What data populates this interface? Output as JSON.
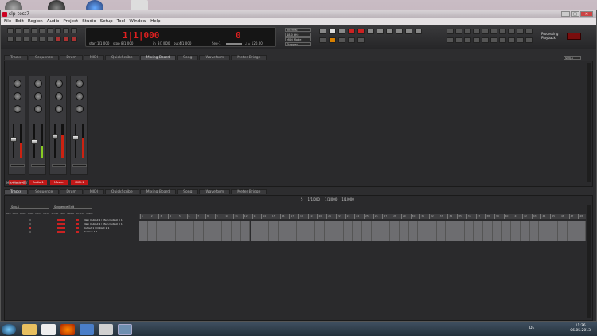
{
  "window": {
    "title": "slp-test7"
  },
  "menu": [
    "File",
    "Edit",
    "Region",
    "Audio",
    "Project",
    "Studio",
    "Setup",
    "Tool",
    "Window",
    "Help"
  ],
  "transport": {
    "main_counter": "1|1|000",
    "start_label": "start",
    "start_value": "1|1|000",
    "stop_label": "stop",
    "stop_value": "8|1|000",
    "in_label": "in",
    "in_value": "3|1|000",
    "out_label": "out",
    "out_value": "4|1|000",
    "sequence": "Seq-1",
    "tempo": "♩ = 120.00",
    "right_counter": "0"
  },
  "sync": [
    "Internal",
    "48.0 kHz",
    "MIDI Mode",
    "Stopped"
  ],
  "status": {
    "line1": "Processing",
    "line2": "Playback"
  },
  "tabs": [
    "Tracks",
    "Sequence",
    "Drum",
    "MIDI",
    "QuickScribe",
    "Mixing Board",
    "Song",
    "Waveform",
    "Meter Bridge"
  ],
  "mixer": {
    "active_tab": "Mixing Board",
    "top_dropdown": "Seq-1",
    "channel_labels": [
      "Instrument",
      "Audio-1",
      "Master",
      "MIDI-1"
    ],
    "track_selector": "Mix Mode Off",
    "meter_levels": [
      0.45,
      0.35,
      0.7,
      0.6
    ],
    "fader_levels": [
      0.62,
      0.55,
      0.72,
      0.66
    ]
  },
  "tracks": {
    "active_tab": "Tracks",
    "sequence_dropdown": "Seq-1",
    "view_dropdown": "Sequence Edit",
    "zoom_labels": [
      "5",
      "1/1|000",
      "1|1|000",
      "1|1|000"
    ],
    "column_headers": [
      "REC",
      "LOCK",
      "LOOP",
      "SOLO",
      "MUTE",
      "INPUT",
      "LEVEL",
      "PLAY",
      "TRACK",
      "OUTPUT",
      "NAME"
    ],
    "rows": [
      "Main Output 1 | Main Output R 1",
      "Main Output 1 | Main Output R 1",
      "Output 1 | Output 2 1",
      "Receive 1 1"
    ],
    "ruler_marks": [
      "1",
      "2",
      "3",
      "4",
      "5",
      "6",
      "7",
      "8",
      "9",
      "10",
      "11",
      "12",
      "13",
      "14",
      "15",
      "16",
      "17",
      "18",
      "19",
      "20",
      "21",
      "22",
      "23",
      "24",
      "25",
      "26",
      "27",
      "28",
      "29",
      "30",
      "31",
      "32",
      "33",
      "34",
      "35",
      "36",
      "37",
      "38",
      "39",
      "40",
      "41",
      "42",
      "43",
      "44",
      "45",
      "46",
      "47",
      "48"
    ]
  },
  "taskbar": {
    "lang": "DE",
    "time": "11:36",
    "date": "06.05.2013"
  }
}
